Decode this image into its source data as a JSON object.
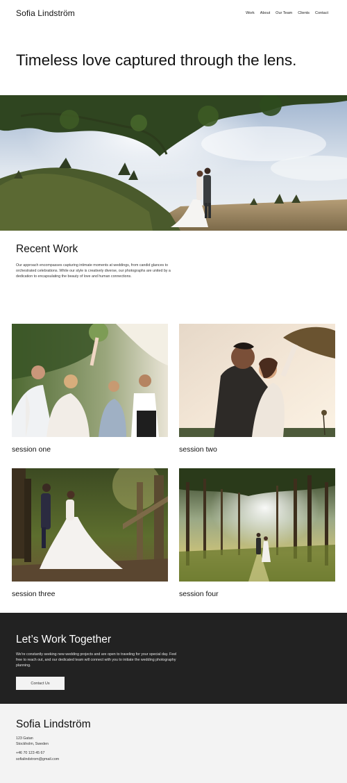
{
  "brand": "Sofia Lindström",
  "nav": [
    "Work",
    "About",
    "Our Team",
    "Clients",
    "Contact"
  ],
  "hero": {
    "title": "Timeless love captured through the lens.",
    "image": "hero-couple-meadow-photo"
  },
  "recent": {
    "title": "Recent Work",
    "description": "Our approach encompasses capturing intimate moments at weddings, from candid glances to orchestrated celebrations. While our style is creatively diverse, our photographs are united by a dedication to encapsulating the beauty of love and human connections."
  },
  "sessions": [
    {
      "caption": "session one",
      "image": "wedding-party-photo"
    },
    {
      "caption": "session two",
      "image": "sunset-couple-photo"
    },
    {
      "caption": "session three",
      "image": "forest-fence-couple-photo"
    },
    {
      "caption": "session four",
      "image": "pine-forest-couple-photo"
    }
  ],
  "cta": {
    "title": "Let’s Work Together",
    "text": "We're constantly seeking new wedding projects and are open to traveling for your special day. Feel free to reach out, and our dedicated team will connect with you to initiate the wedding photography planning.",
    "button": "Contact Us",
    "background": "#222222"
  },
  "footer": {
    "brand": "Sofia Lindström",
    "address1": "123 Gatan",
    "address2": "Stockholm, Sweden",
    "phone": "+46 70 123 45 67",
    "email": "sofialindstrom@gmail.com"
  }
}
